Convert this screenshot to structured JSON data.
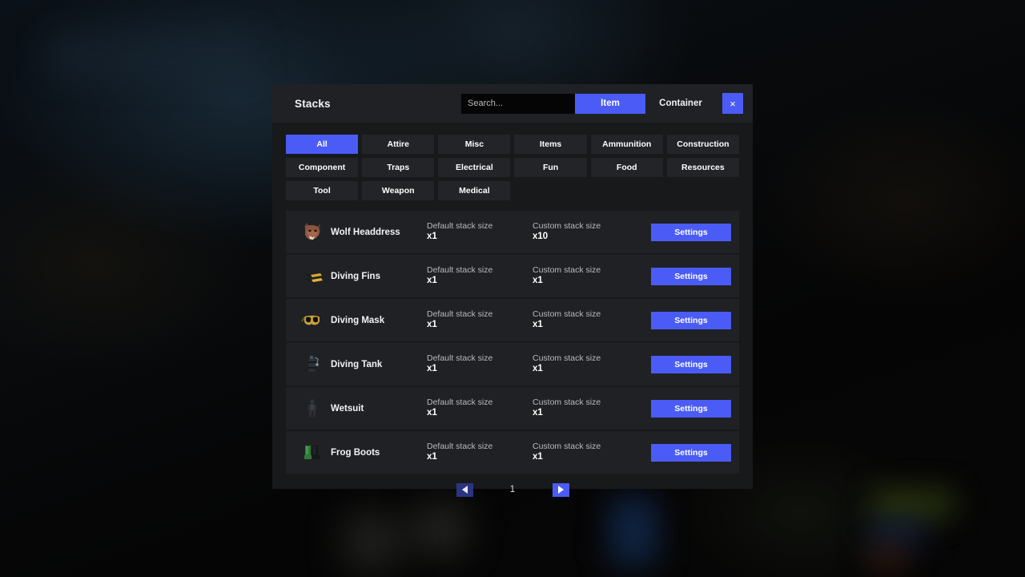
{
  "background": {
    "description": "blurred dark game scene"
  },
  "dialog": {
    "title": "Stacks",
    "search": {
      "placeholder": "Search...",
      "value": ""
    },
    "mode_buttons": [
      {
        "label": "Item",
        "active": true
      },
      {
        "label": "Container",
        "active": false
      }
    ],
    "close_label": "×",
    "close_icon": "close-icon",
    "accent_color": "#4a5cf5",
    "panel_color": "#18191b",
    "row_color": "#202124",
    "header_color": "#202124"
  },
  "categories": [
    {
      "label": "All",
      "active": true
    },
    {
      "label": "Attire",
      "active": false
    },
    {
      "label": "Misc",
      "active": false
    },
    {
      "label": "Items",
      "active": false
    },
    {
      "label": "Ammunition",
      "active": false
    },
    {
      "label": "Construction",
      "active": false
    },
    {
      "label": "Component",
      "active": false
    },
    {
      "label": "Traps",
      "active": false
    },
    {
      "label": "Electrical",
      "active": false
    },
    {
      "label": "Fun",
      "active": false
    },
    {
      "label": "Food",
      "active": false
    },
    {
      "label": "Resources",
      "active": false
    },
    {
      "label": "Tool",
      "active": false
    },
    {
      "label": "Weapon",
      "active": false
    },
    {
      "label": "Medical",
      "active": false
    }
  ],
  "list": {
    "default_label": "Default stack size",
    "custom_label": "Custom stack size",
    "settings_label": "Settings",
    "items": [
      {
        "name": "Wolf Headdress",
        "icon": "wolf-headdress-icon",
        "default_stack": "x1",
        "custom_stack": "x10"
      },
      {
        "name": "Diving Fins",
        "icon": "diving-fins-icon",
        "default_stack": "x1",
        "custom_stack": "x1"
      },
      {
        "name": "Diving Mask",
        "icon": "diving-mask-icon",
        "default_stack": "x1",
        "custom_stack": "x1"
      },
      {
        "name": "Diving Tank",
        "icon": "diving-tank-icon",
        "default_stack": "x1",
        "custom_stack": "x1"
      },
      {
        "name": "Wetsuit",
        "icon": "wetsuit-icon",
        "default_stack": "x1",
        "custom_stack": "x1"
      },
      {
        "name": "Frog Boots",
        "icon": "frog-boots-icon",
        "default_stack": "x1",
        "custom_stack": "x1"
      }
    ]
  },
  "pagination": {
    "prev_label": "◀",
    "next_label": "▶",
    "current_page": "1"
  }
}
